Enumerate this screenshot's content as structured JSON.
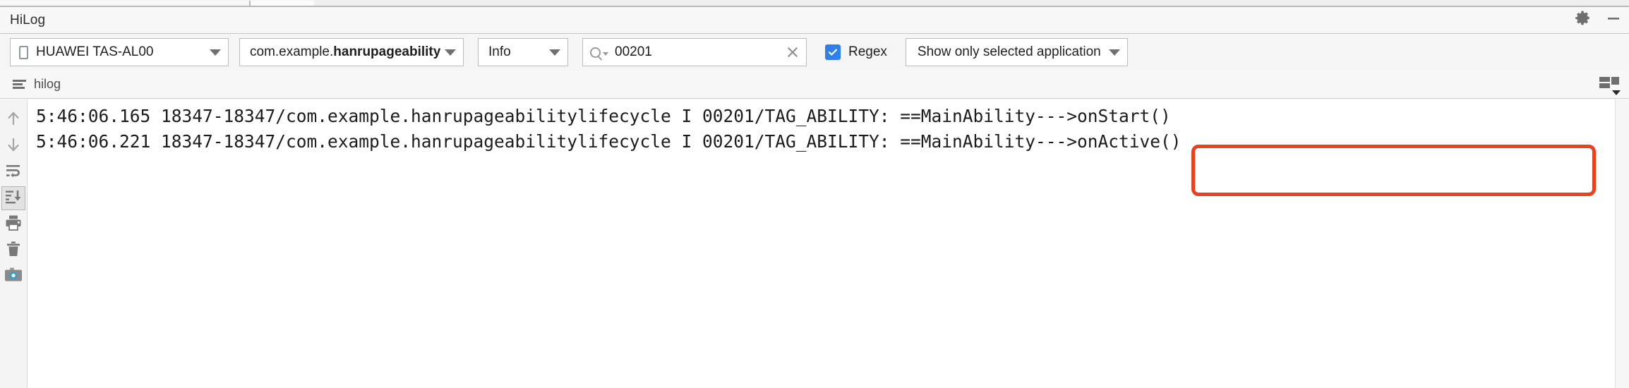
{
  "window": {
    "title": "HiLog",
    "settings_icon": "gear-icon",
    "minimize_icon": "minimize-icon"
  },
  "toolbar": {
    "device": {
      "value": "HUAWEI TAS-AL00",
      "icon": "phone-icon"
    },
    "process": {
      "prefix": "com.example.",
      "bold": "hanrupageability"
    },
    "level": {
      "value": "Info"
    },
    "search": {
      "value": "00201",
      "placeholder": "Search",
      "search_icon": "search-icon",
      "clear_icon": "close-icon"
    },
    "regex": {
      "label": "Regex",
      "checked": true,
      "accent": "#2f7fed"
    },
    "scope": {
      "value": "Show only selected application"
    }
  },
  "subtabs": {
    "items": [
      {
        "label": "hilog",
        "icon": "lines-icon"
      }
    ],
    "layout_icon": "column-layout-icon"
  },
  "rail": {
    "items": [
      {
        "name": "scroll-up-button",
        "icon": "arrow-up-icon",
        "active": false
      },
      {
        "name": "scroll-down-button",
        "icon": "arrow-down-icon",
        "active": false
      },
      {
        "name": "soft-wrap-button",
        "icon": "soft-wrap-icon",
        "active": false
      },
      {
        "name": "scroll-to-end-button",
        "icon": "scroll-to-end-icon",
        "active": true
      },
      {
        "name": "print-button",
        "icon": "printer-icon",
        "active": false
      },
      {
        "name": "clear-log-button",
        "icon": "trash-icon",
        "active": false
      },
      {
        "name": "screenshot-button",
        "icon": "camera-icon",
        "active": false
      }
    ]
  },
  "log": {
    "lines": [
      "5:46:06.165 18347-18347/com.example.hanrupageabilitylifecycle I 00201/TAG_ABILITY: ==MainAbility--->onStart()",
      "5:46:06.221 18347-18347/com.example.hanrupageabilitylifecycle I 00201/TAG_ABILITY: ==MainAbility--->onActive()"
    ]
  },
  "annotation": {
    "color": "#e8431f",
    "shape": "rounded-rectangle"
  }
}
